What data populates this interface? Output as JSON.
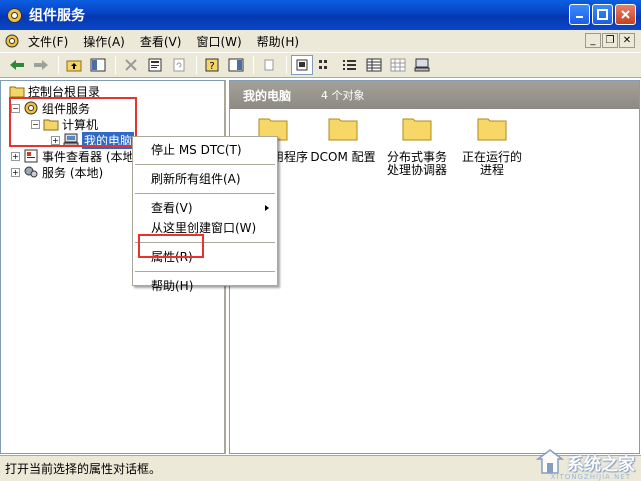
{
  "window": {
    "title": "组件服务"
  },
  "menubar": {
    "items": [
      {
        "label": "文件(F)"
      },
      {
        "label": "操作(A)"
      },
      {
        "label": "查看(V)"
      },
      {
        "label": "窗口(W)"
      },
      {
        "label": "帮助(H)"
      }
    ]
  },
  "tree": {
    "root": "控制台根目录",
    "component_services": "组件服务",
    "computers": "计算机",
    "my_computer": "我的电脑",
    "event_viewer": "事件查看器 (本地)",
    "services": "服务 (本地)"
  },
  "right_pane": {
    "title": "我的电脑",
    "count": "4 个对象",
    "items": [
      {
        "label": "COM+ 应用程序",
        "visible_label": "用程序"
      },
      {
        "label": "DCOM 配置"
      },
      {
        "label": "分布式事务处理协调器"
      },
      {
        "label": "正在运行的进程"
      }
    ]
  },
  "context_menu": {
    "stop_msdtc": "停止 MS DTC(T)",
    "refresh_all": "刷新所有组件(A)",
    "view": "查看(V)",
    "new_window": "从这里创建窗口(W)",
    "properties": "属性(R)",
    "help": "帮助(H)"
  },
  "status": {
    "text": "打开当前选择的属性对话框。"
  },
  "watermark": {
    "text": "系统之家",
    "sub": "XITONGZHIJIA.NET"
  },
  "colors": {
    "title_blue": "#0a46c8",
    "selection": "#316ac5",
    "highlight_box": "#e5332e",
    "chrome": "#ece9d8"
  }
}
